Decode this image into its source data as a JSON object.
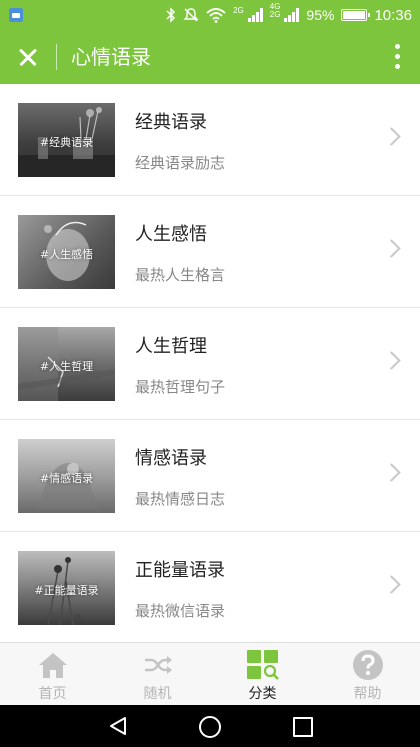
{
  "status_bar": {
    "network_top": "2G",
    "network_4g": "4G",
    "network_2g": "2G",
    "battery": "95%",
    "time": "10:36",
    "icons": [
      "notification-app-icon",
      "bluetooth-icon",
      "mute-icon",
      "wifi-icon",
      "signal-icon",
      "battery-icon"
    ]
  },
  "app_bar": {
    "title": "心情语录",
    "close_icon": "close-icon",
    "more_icon": "more-vertical-icon",
    "color": "#7cc53c"
  },
  "categories": [
    {
      "tag": "#经典语录",
      "title": "经典语录",
      "subtitle": "经典语录励志"
    },
    {
      "tag": "#人生感悟",
      "title": "人生感悟",
      "subtitle": "最热人生格言"
    },
    {
      "tag": "#人生哲理",
      "title": "人生哲理",
      "subtitle": "最热哲理句子"
    },
    {
      "tag": "#情感语录",
      "title": "情感语录",
      "subtitle": "最热情感日志"
    },
    {
      "tag": "#正能量语录",
      "title": "正能量语录",
      "subtitle": "最热微信语录"
    }
  ],
  "tab_bar": {
    "tabs": [
      {
        "label": "首页",
        "icon": "home-icon",
        "active": false
      },
      {
        "label": "随机",
        "icon": "shuffle-icon",
        "active": false
      },
      {
        "label": "分类",
        "icon": "category-icon",
        "active": true
      },
      {
        "label": "帮助",
        "icon": "help-icon",
        "active": false
      }
    ],
    "active_color": "#7cc53c",
    "inactive_color": "#c4c4c4"
  },
  "nav_bar": {
    "icons": [
      "back-icon",
      "home-circle-icon",
      "recent-apps-icon"
    ]
  }
}
